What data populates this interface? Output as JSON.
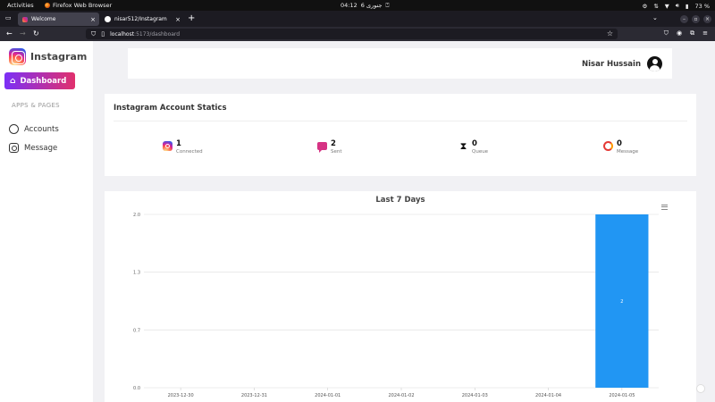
{
  "system": {
    "activities": "Activities",
    "app_name": "Firefox Web Browser",
    "clock_time": "04:12",
    "clock_day": "6 جنوری",
    "battery": "73 %"
  },
  "browser": {
    "tabs": [
      {
        "title": "Welcome",
        "active": true
      },
      {
        "title": "nisar512/Instagram",
        "active": false
      }
    ],
    "url_host": "localhost",
    "url_path": ":5173/dashboard"
  },
  "app": {
    "brand": "Instagram",
    "nav_dashboard": "Dashboard",
    "section_label": "APPS & PAGES",
    "nav_items": [
      {
        "label": "Accounts",
        "icon": "account-circle-icon"
      },
      {
        "label": "Message",
        "icon": "instagram-icon"
      }
    ],
    "user_name": "Nisar Hussain"
  },
  "stats": {
    "title": "Instagram Account Statics",
    "items": [
      {
        "value": "1",
        "label": "Connected",
        "icon": "instagram-icon"
      },
      {
        "value": "2",
        "label": "Sent",
        "icon": "message-icon"
      },
      {
        "value": "0",
        "label": "Queue",
        "icon": "hourglass-icon"
      },
      {
        "value": "0",
        "label": "Message",
        "icon": "blocked-icon"
      }
    ]
  },
  "chart_data": {
    "type": "bar",
    "title": "Last 7 Days",
    "categories": [
      "2023-12-30",
      "2023-12-31",
      "2024-01-01",
      "2024-01-02",
      "2024-01-03",
      "2024-01-04",
      "2024-01-05"
    ],
    "values": [
      0,
      0,
      0,
      0,
      0,
      0,
      2
    ],
    "data_labels": [
      "",
      "",
      "",
      "",
      "",
      "",
      "2"
    ],
    "yticks": [
      "0.0",
      "0.7",
      "1.3",
      "2.0"
    ],
    "ylim": [
      0,
      2
    ],
    "bar_color": "#2196f3",
    "grid": true
  }
}
